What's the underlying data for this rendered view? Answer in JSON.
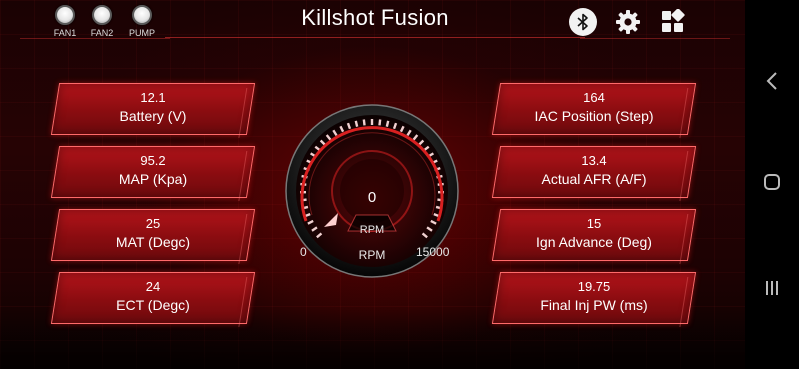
{
  "app": {
    "title": "Killshot Fusion"
  },
  "status_indicators": [
    {
      "label": "FAN1",
      "icon": "status-dot-icon"
    },
    {
      "label": "FAN2",
      "icon": "status-dot-icon"
    },
    {
      "label": "PUMP",
      "icon": "status-dot-icon"
    }
  ],
  "toolbar": {
    "bluetooth_icon": "bluetooth-icon",
    "settings_icon": "gear-icon",
    "layout_icon": "dashboard-grid-icon"
  },
  "tiles_left": [
    {
      "value": "12.1",
      "label": "Battery (V)"
    },
    {
      "value": "95.2",
      "label": "MAP (Kpa)"
    },
    {
      "value": "25",
      "label": "MAT (Degc)"
    },
    {
      "value": "24",
      "label": "ECT (Degc)"
    }
  ],
  "tiles_right": [
    {
      "value": "164",
      "label": "IAC Position (Step)"
    },
    {
      "value": "13.4",
      "label": "Actual AFR (A/F)"
    },
    {
      "value": "15",
      "label": "Ign Advance (Deg)"
    },
    {
      "value": "19.75",
      "label": "Final Inj PW (ms)"
    }
  ],
  "gauge": {
    "value": "0",
    "unit_top": "RPM",
    "unit_bottom": "RPM",
    "min": "0",
    "max": "15000",
    "fill_fraction": 0.0
  },
  "colors": {
    "accent_red": "#b2141a",
    "tile_border": "#ff6a6a",
    "background": "#1a0203"
  },
  "system_nav": {
    "back_icon": "back-chevron-icon",
    "home_icon": "home-square-icon",
    "recents_icon": "recents-bars-icon"
  }
}
